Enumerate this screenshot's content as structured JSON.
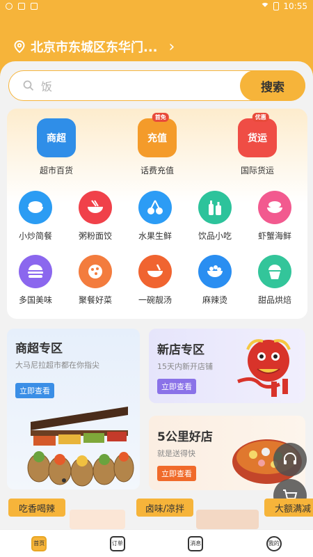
{
  "status": {
    "time": "10:55"
  },
  "location": {
    "address": "北京市东城区东华门..."
  },
  "search": {
    "placeholder": "饭",
    "button": "搜索"
  },
  "top_categories": [
    {
      "label": "超市百货",
      "tile_text": "商超",
      "tag": "",
      "color": "#2f8ee8",
      "icon": "basket-icon"
    },
    {
      "label": "话费充值",
      "tile_text": "充值",
      "tag": "首免",
      "color": "#f49b2a",
      "icon": "phone-topup-icon"
    },
    {
      "label": "国际货运",
      "tile_text": "货运",
      "tag": "优惠",
      "color": "#ef4d45",
      "icon": "truck-icon"
    }
  ],
  "categories_row1": [
    {
      "label": "小炒简餐",
      "color": "#2b9cf3",
      "icon": "rice-bowl-icon"
    },
    {
      "label": "粥粉面饺",
      "color": "#f0414a",
      "icon": "noodle-bowl-icon"
    },
    {
      "label": "水果生鲜",
      "color": "#2c9cf5",
      "icon": "cherry-icon"
    },
    {
      "label": "饮品小吃",
      "color": "#2dc39b",
      "icon": "bottles-icon"
    },
    {
      "label": "虾蟹海鲜",
      "color": "#f25a8f",
      "icon": "seafood-icon"
    }
  ],
  "categories_row2": [
    {
      "label": "多国美味",
      "color": "#8b67ee",
      "icon": "burger-icon"
    },
    {
      "label": "聚餐好菜",
      "color": "#f37c3e",
      "icon": "pizza-icon"
    },
    {
      "label": "一碗靓汤",
      "color": "#f06430",
      "icon": "soup-icon"
    },
    {
      "label": "麻辣烫",
      "color": "#2a8ef1",
      "icon": "hotpot-bowl-icon"
    },
    {
      "label": "甜品烘焙",
      "color": "#33c59a",
      "icon": "cupcake-icon"
    }
  ],
  "promos": {
    "supermarket": {
      "title": "商超专区",
      "subtitle": "大马尼拉超市都在你指尖",
      "button": "立即查看"
    },
    "new_store": {
      "title": "新店专区",
      "subtitle": "15天内新开店铺",
      "button": "立即查看"
    },
    "nearby": {
      "title": "5公里好店",
      "subtitle": "就是送得快",
      "button": "立即查看"
    }
  },
  "bottom_tabs": [
    "吃香喝辣",
    "卤味/凉拌",
    "大额满减"
  ],
  "nav": [
    {
      "label": "首页",
      "icon": "home-icon"
    },
    {
      "label": "订单",
      "icon": "orders-icon"
    },
    {
      "label": "消息",
      "icon": "message-icon"
    },
    {
      "label": "我的",
      "icon": "profile-icon"
    }
  ]
}
